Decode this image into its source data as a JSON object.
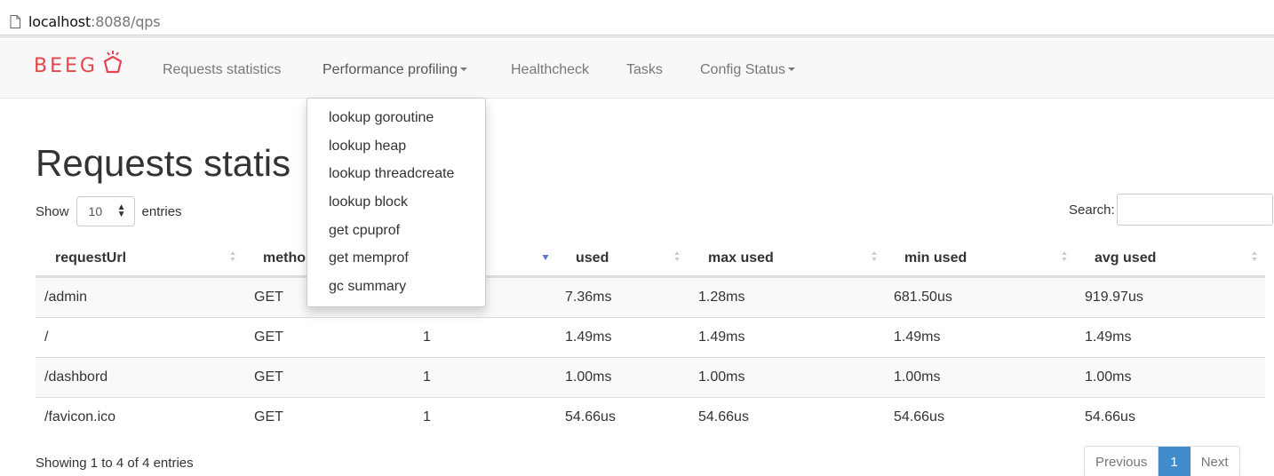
{
  "browser": {
    "url_host": "localhost",
    "url_rest": ":8088/qps"
  },
  "navbar": {
    "brand": "BEEG",
    "items": [
      {
        "label": "Requests statistics"
      },
      {
        "label": "Performance profiling"
      },
      {
        "label": "Healthcheck"
      },
      {
        "label": "Tasks"
      },
      {
        "label": "Config Status"
      }
    ]
  },
  "dropdown": {
    "items": [
      {
        "label": "lookup goroutine"
      },
      {
        "label": "lookup heap"
      },
      {
        "label": "lookup threadcreate"
      },
      {
        "label": "lookup block"
      },
      {
        "label": "get cpuprof"
      },
      {
        "label": "get memprof"
      },
      {
        "label": "gc summary"
      }
    ]
  },
  "main": {
    "title": "Requests statis",
    "length": {
      "prefix": "Show",
      "value": "10",
      "suffix": "entries"
    },
    "search_label": "Search:",
    "columns": [
      "requestUrl",
      "metho",
      "",
      "used",
      "max used",
      "min used",
      "avg used"
    ],
    "rows": [
      [
        "/admin",
        "GET",
        "",
        "7.36ms",
        "1.28ms",
        "681.50us",
        "919.97us"
      ],
      [
        "/",
        "GET",
        "1",
        "1.49ms",
        "1.49ms",
        "1.49ms",
        "1.49ms"
      ],
      [
        "/dashbord",
        "GET",
        "1",
        "1.00ms",
        "1.00ms",
        "1.00ms",
        "1.00ms"
      ],
      [
        "/favicon.ico",
        "GET",
        "1",
        "54.66us",
        "54.66us",
        "54.66us",
        "54.66us"
      ]
    ],
    "info": "Showing 1 to 4 of 4 entries",
    "pagination": {
      "previous": "Previous",
      "current": "1",
      "next": "Next"
    }
  },
  "colors": {
    "brand": "#e5454c",
    "active_page": "#428bca",
    "sort_active": "#5a78c8"
  }
}
